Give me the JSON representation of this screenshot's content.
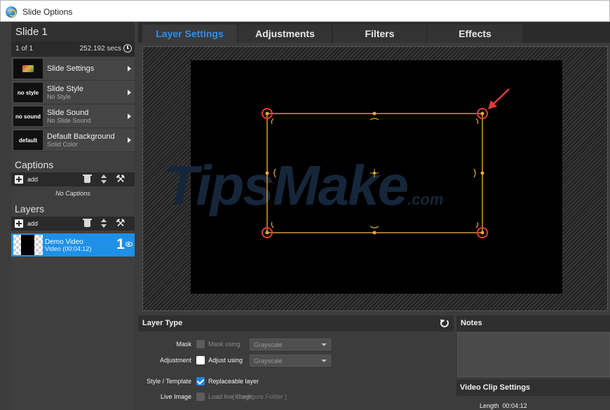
{
  "window": {
    "title": "Slide Options"
  },
  "slide": {
    "title": "Slide 1",
    "count": "1 of 1",
    "duration": "252.192 secs"
  },
  "options": [
    {
      "thumb": "",
      "name": "Slide Settings",
      "sub": ""
    },
    {
      "thumb": "no style",
      "name": "Slide Style",
      "sub": "No Style"
    },
    {
      "thumb": "no sound",
      "name": "Slide Sound",
      "sub": "No Slide Sound"
    },
    {
      "thumb": "default",
      "name": "Default Background",
      "sub": "Solid Color"
    }
  ],
  "captions": {
    "title": "Captions",
    "add_label": "add",
    "empty_text": "No Captions"
  },
  "layers": {
    "title": "Layers",
    "add_label": "add",
    "items": [
      {
        "name": "Demo Video",
        "sub": "Video (00:04:12)",
        "number": "1"
      }
    ]
  },
  "tabs": [
    "Layer Settings",
    "Adjustments",
    "Filters",
    "Effects"
  ],
  "watermark": {
    "main": "TipsMake",
    "suffix": ".com"
  },
  "layer_type": {
    "title": "Layer Type",
    "mask": {
      "label": "Mask",
      "check_text": "Mask using",
      "select": "Grayscale",
      "checked": false,
      "enabled": false
    },
    "adjustment": {
      "label": "Adjustment",
      "check_text": "Adjust using",
      "select": "Grayscale",
      "checked": false,
      "enabled": true
    },
    "style": {
      "label": "Style / Template",
      "check_text": "Replaceable layer",
      "checked": true
    },
    "live": {
      "label": "Live Image",
      "check_text": "Load live image",
      "configure": "[ Configure Folder ]",
      "checked": false,
      "enabled": false
    }
  },
  "notes": {
    "title": "Notes"
  },
  "video_clip": {
    "title": "Video Clip Settings",
    "length_label": "Length",
    "length_value": "00:04:12"
  },
  "colors": {
    "accent": "#1e90e8",
    "active_tab": "#2f8fe6",
    "handles": "#e8a93a",
    "corner_marker": "#e23b3b"
  }
}
